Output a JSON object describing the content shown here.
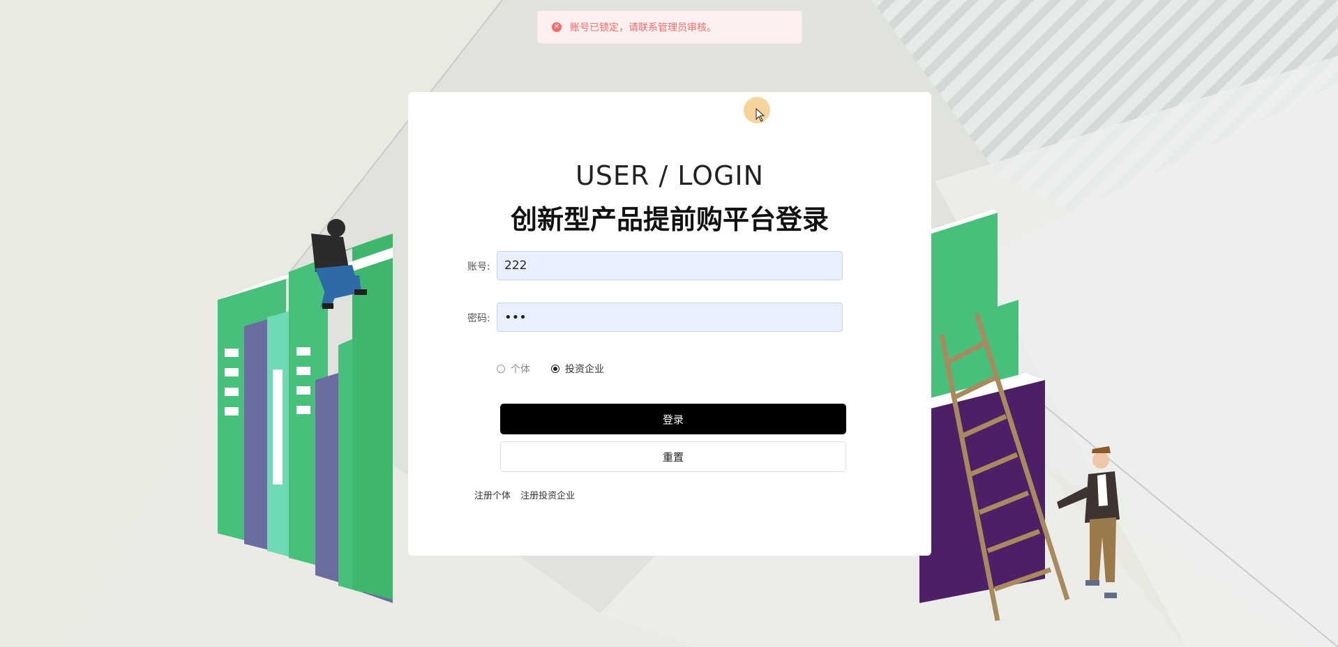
{
  "toast": {
    "icon": "error-circle-icon",
    "message": "账号已锁定，请联系管理员审核。",
    "color": "#f56c6c"
  },
  "login": {
    "title_en": "USER / LOGIN",
    "title_cn": "创新型产品提前购平台登录",
    "account_label": "账号:",
    "account_value": "222",
    "password_label": "密码:",
    "password_value": "***",
    "roles": [
      {
        "label": "个体",
        "selected": false
      },
      {
        "label": "投资企业",
        "selected": true
      }
    ],
    "login_button": "登录",
    "reset_button": "重置",
    "links": [
      "注册个体",
      "注册投资企业"
    ]
  },
  "theme": {
    "accent": "#000000",
    "book_green": "#46c07a",
    "book_purple": "#6a6e9e",
    "input_bg": "#e8f0fe"
  }
}
